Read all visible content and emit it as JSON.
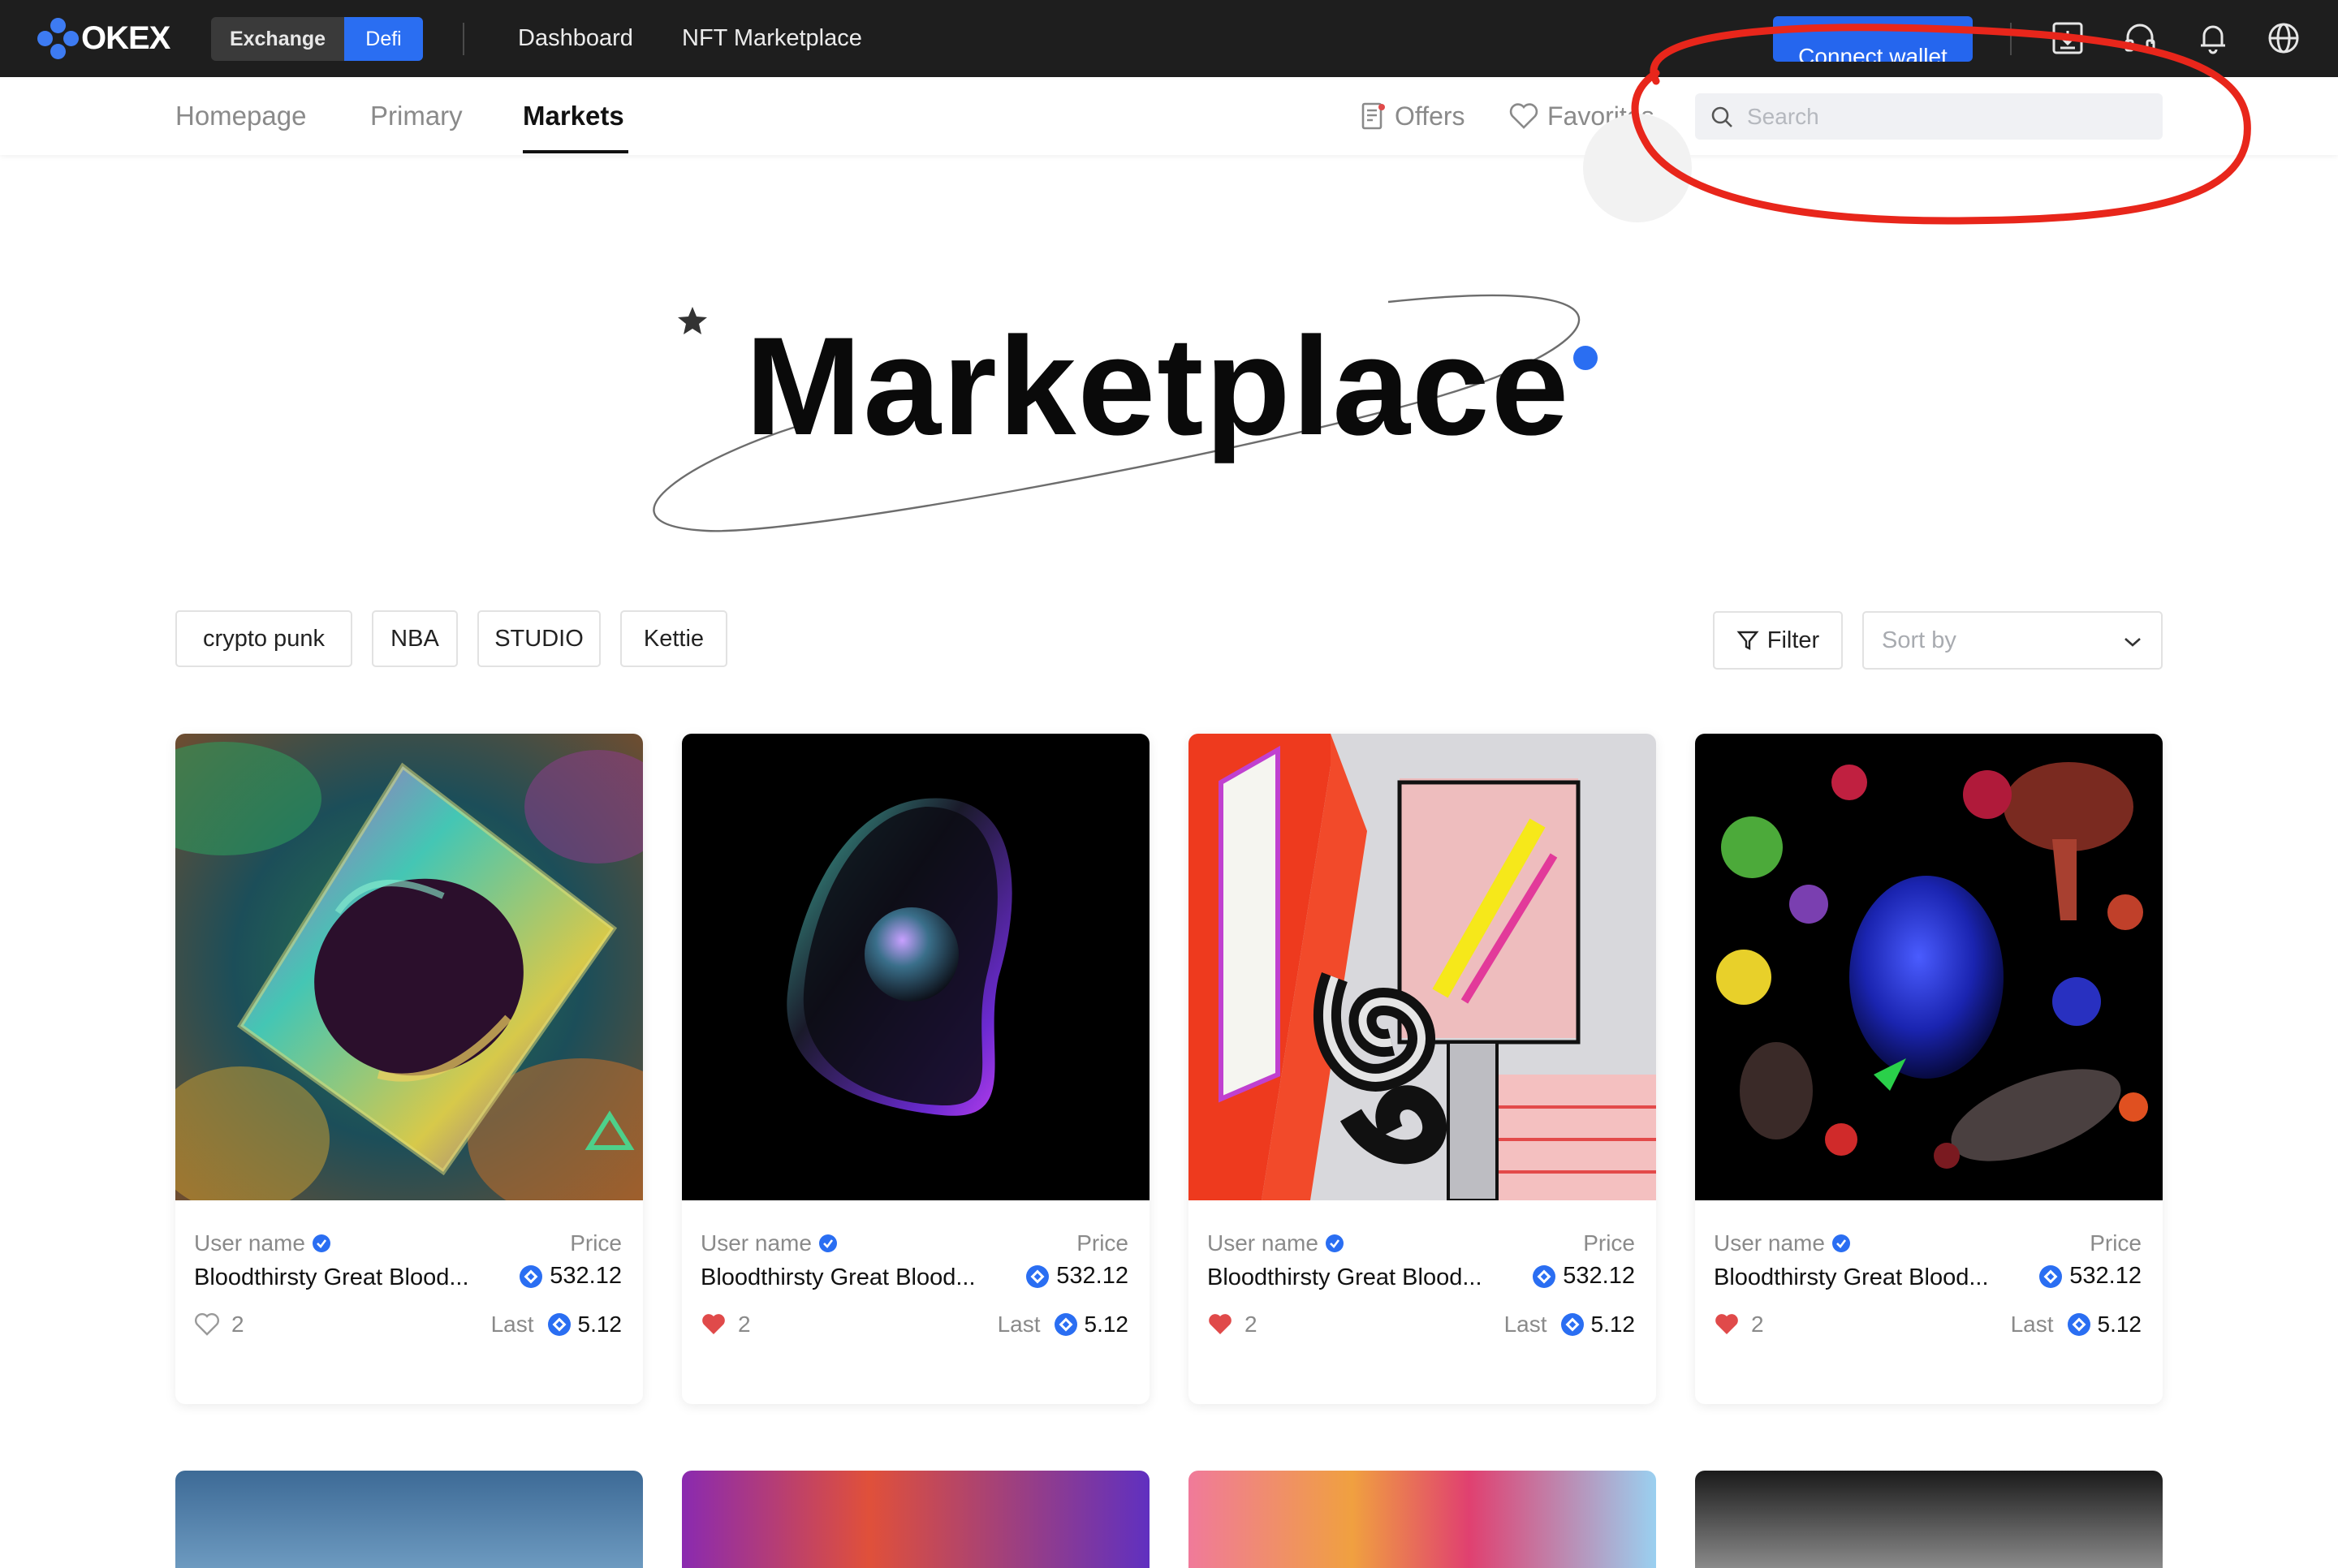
{
  "brand": {
    "name": "OKEX"
  },
  "mode_switch": {
    "exchange": "Exchange",
    "defi": "Defi"
  },
  "top_nav": {
    "dashboard": "Dashboard",
    "nft_marketplace": "NFT Marketplace"
  },
  "connect_wallet": "Connect wallet",
  "sub_tabs": {
    "homepage": "Homepage",
    "primary": "Primary",
    "markets": "Markets"
  },
  "right_links": {
    "offers": "Offers",
    "favorites": "Favorites"
  },
  "search": {
    "placeholder": "Search"
  },
  "hero": {
    "title": "Marketplace"
  },
  "tags": [
    "crypto punk",
    "NBA",
    "STUDIO",
    "Kettie"
  ],
  "filter": {
    "label": "Filter"
  },
  "sort": {
    "placeholder": "Sort by"
  },
  "cards": [
    {
      "user": "User name",
      "price_label": "Price",
      "title": "Bloodthirsty Great Blood...",
      "price": "532.12",
      "likes": "2",
      "liked": false,
      "last_label": "Last",
      "last_price": "5.12"
    },
    {
      "user": "User name",
      "price_label": "Price",
      "title": "Bloodthirsty Great Blood...",
      "price": "532.12",
      "likes": "2",
      "liked": true,
      "last_label": "Last",
      "last_price": "5.12"
    },
    {
      "user": "User name",
      "price_label": "Price",
      "title": "Bloodthirsty Great Blood...",
      "price": "532.12",
      "likes": "2",
      "liked": true,
      "last_label": "Last",
      "last_price": "5.12"
    },
    {
      "user": "User name",
      "price_label": "Price",
      "title": "Bloodthirsty Great Blood...",
      "price": "532.12",
      "likes": "2",
      "liked": true,
      "last_label": "Last",
      "last_price": "5.12"
    }
  ],
  "icons": {
    "top": [
      "download-icon",
      "headset-icon",
      "bell-icon",
      "globe-icon"
    ],
    "search": "search-icon",
    "offers": "document-icon",
    "favorites": "heart-outline-icon",
    "verified": "verified-badge-icon",
    "coin": "okex-coin-icon",
    "sort": "chevron-down-icon",
    "filter": "funnel-icon"
  },
  "colors": {
    "accent": "#2a6ef2",
    "topbar": "#1e1e1e",
    "like": "#e04a4a",
    "annotation": "#e8261b"
  }
}
